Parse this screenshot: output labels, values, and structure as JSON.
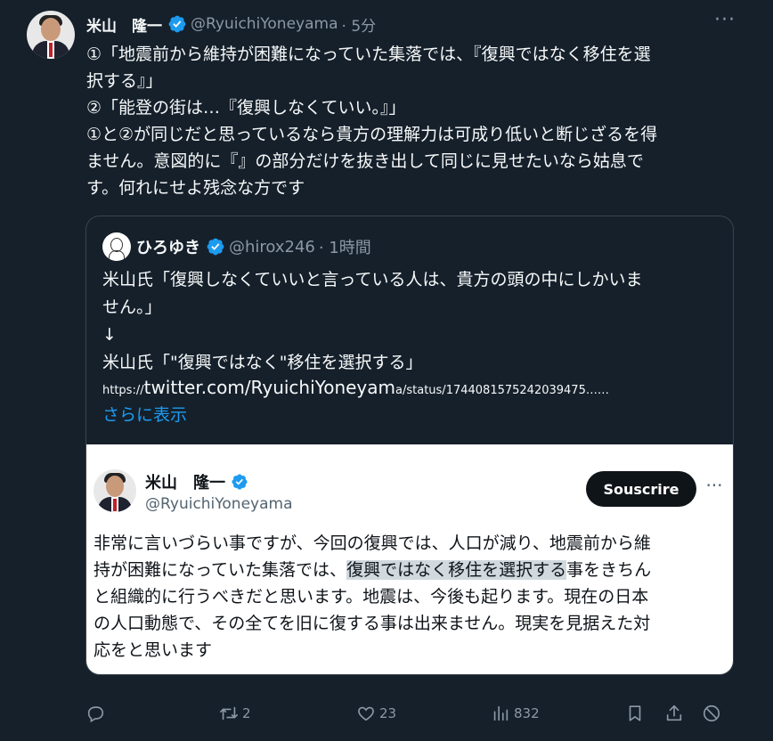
{
  "author": {
    "name": "米山　隆一",
    "handle": "@RyuichiYoneyama",
    "time": "· 5分"
  },
  "tweet": {
    "lines": [
      "①「地震前から維持が困難になっていた集落では、『復興ではなく移住を選",
      "択する』」",
      "②「能登の街は…『復興しなくていい。』」",
      "①と②が同じだと思っているなら貴方の理解力は可成り低いと断じざるを得",
      "ません。意図的に『』の部分だけを抜き出して同じに見せたいなら姑息で",
      "す。何れにせよ残念な方です"
    ]
  },
  "quote": {
    "name": "ひろゆき",
    "handle": "@hirox246",
    "time": "· 1時間",
    "lines": [
      "米山氏「復興しなくていいと言っている人は、貴方の頭の中にしかいま",
      "せん。」",
      "↓",
      "米山氏「\"復興ではなく\"移住を選択する」"
    ],
    "link_prefix": "https://",
    "link_main": "twitter.com/RyuichiYoneyam",
    "link_suffix": "a/status/1744081575242039475……",
    "show_more": "さらに表示",
    "embed": {
      "name": "米山　隆一",
      "handle": "@RyuichiYoneyama",
      "subscribe": "Souscrire",
      "line1": "非常に言いづらい事ですが、今回の復興では、人口が減り、地震前から維",
      "line2_pre": "持が困難になっていた集落では、",
      "line2_hl": "復興ではなく移住を選択する",
      "line2_post": "事をきちん",
      "line3": "と組織的に行うべきだと思います。地震は、今後も起ります。現在の日本",
      "line4": "の人口動態で、その全てを旧に復する事は出来ません。現実を見据えた対",
      "line5": "応をと思います"
    }
  },
  "actions": {
    "replies": "",
    "retweets": "2",
    "likes": "23",
    "views": "832"
  },
  "colors": {
    "background": "#15202b",
    "accent": "#1d9bf0",
    "muted": "#8b98a5"
  }
}
